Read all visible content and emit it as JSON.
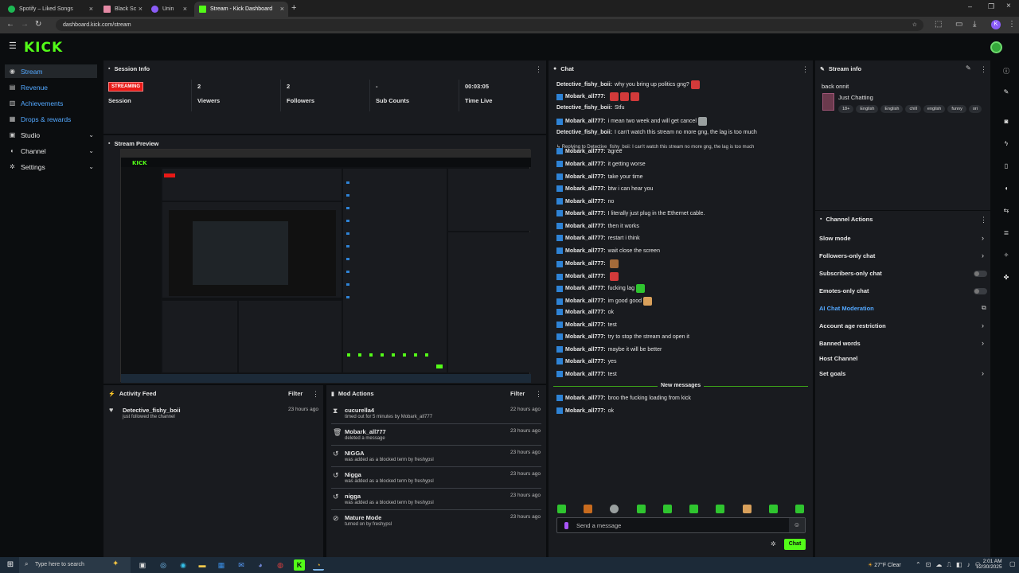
{
  "browser": {
    "tabs": [
      {
        "label": "Spotify – Liked Songs",
        "color": "#1db954"
      },
      {
        "label": "Black Sc",
        "color": "#e58aa5"
      },
      {
        "label": "Unin",
        "color": "#8a5cf6"
      },
      {
        "label": "Stream - Kick Dashboard",
        "color": "#53fc18"
      }
    ],
    "url": "dashboard.kick.com/stream"
  },
  "brand": {
    "logo": "KICK",
    "accent": "#53fc18",
    "link_blue": "#53a8ff"
  },
  "sidebar": {
    "items": [
      {
        "label": "Stream",
        "icon": "broadcast-icon"
      },
      {
        "label": "Revenue",
        "icon": "dollar-icon"
      },
      {
        "label": "Achievements",
        "icon": "trophy-icon"
      },
      {
        "label": "Drops & rewards",
        "icon": "gift-icon"
      },
      {
        "label": "Studio",
        "icon": "video-icon"
      },
      {
        "label": "Channel",
        "icon": "user-icon"
      },
      {
        "label": "Settings",
        "icon": "gear-icon"
      }
    ]
  },
  "session": {
    "title": "Session Info",
    "badge": "STREAMING",
    "session_label": "Session",
    "stats": [
      {
        "value": "2",
        "label": "Viewers"
      },
      {
        "value": "2",
        "label": "Followers"
      },
      {
        "value": "-",
        "label": "Sub Counts"
      },
      {
        "value": "00:03:05",
        "label": "Time Live"
      }
    ]
  },
  "preview": {
    "title": "Stream Preview"
  },
  "activity": {
    "title": "Activity Feed",
    "filter": "Filter",
    "items": [
      {
        "name": "Detective_fishy_boii",
        "desc": "just followed the channel",
        "time": "23 hours ago"
      }
    ]
  },
  "mod": {
    "title": "Mod Actions",
    "filter": "Filter",
    "items": [
      {
        "name": "cucurella4",
        "desc": "timed out for 5 minutes by Mobark_all777",
        "time": "22 hours ago",
        "icon": "hourglass-icon"
      },
      {
        "name": "Mobark_all777",
        "desc": "deleted a message",
        "time": "23 hours ago",
        "icon": "trash-icon"
      },
      {
        "name": "NIGGA",
        "desc": "was added as a blocked term by freshypsl",
        "time": "23 hours ago",
        "icon": "undo-icon"
      },
      {
        "name": "Nigga",
        "desc": "was added as a blocked term by freshypsl",
        "time": "23 hours ago",
        "icon": "undo-icon"
      },
      {
        "name": "nigga",
        "desc": "was added as a blocked term by freshypsl",
        "time": "23 hours ago",
        "icon": "undo-icon"
      },
      {
        "name": "Mature Mode",
        "desc": "turned on by freshypsl",
        "time": "23 hours ago",
        "icon": "slash-icon"
      }
    ]
  },
  "chat": {
    "title": "Chat",
    "messages": [
      {
        "user": "Detective_fishy_boii:",
        "text": "why you bring up politics gng?",
        "badge": false,
        "emotes": 1
      },
      {
        "user": "Mobark_all777:",
        "text": "",
        "badge": true,
        "emotes": 3
      },
      {
        "user": "Detective_fishy_boii:",
        "text": "Stfu",
        "badge": false,
        "emotes": 0
      },
      {
        "user": "Mobark_all777:",
        "text": "i mean two week and will get cancel",
        "badge": true,
        "emotes": 1
      },
      {
        "user": "Detective_fishy_boii:",
        "text": "I can't watch this stream no more gng, the lag is too much",
        "badge": false,
        "emotes": 0
      },
      {
        "user": "Mobark_all777:",
        "text": "agree",
        "badge": true,
        "emotes": 0,
        "reply": "Replying to Detective_fishy_boii: I can't watch this stream no more gng, the lag is too much"
      },
      {
        "user": "Mobark_all777:",
        "text": "it getting worse",
        "badge": true,
        "emotes": 0
      },
      {
        "user": "Mobark_all777:",
        "text": "take your time",
        "badge": true,
        "emotes": 0
      },
      {
        "user": "Mobark_all777:",
        "text": "btw i can hear you",
        "badge": true,
        "emotes": 0
      },
      {
        "user": "Mobark_all777:",
        "text": "no",
        "badge": true,
        "emotes": 0
      },
      {
        "user": "Mobark_all777:",
        "text": "I literally just plug in the Ethernet cable.",
        "badge": true,
        "emotes": 0
      },
      {
        "user": "Mobark_all777:",
        "text": "then it works",
        "badge": true,
        "emotes": 0
      },
      {
        "user": "Mobark_all777:",
        "text": "restart i think",
        "badge": true,
        "emotes": 0
      },
      {
        "user": "Mobark_all777:",
        "text": "wait close the screen",
        "badge": true,
        "emotes": 0
      },
      {
        "user": "Mobark_all777:",
        "text": "",
        "badge": true,
        "emotes": 1
      },
      {
        "user": "Mobark_all777:",
        "text": "",
        "badge": true,
        "emotes": 1
      },
      {
        "user": "Mobark_all777:",
        "text": "fucking lag",
        "badge": true,
        "emotes": 1
      },
      {
        "user": "Mobark_all777:",
        "text": "im good good",
        "badge": true,
        "emotes": 1
      },
      {
        "user": "Mobark_all777:",
        "text": "ok",
        "badge": true,
        "emotes": 0
      },
      {
        "user": "Mobark_all777:",
        "text": "test",
        "badge": true,
        "emotes": 0
      },
      {
        "user": "Mobark_all777:",
        "text": "try to stop the stream and open it",
        "badge": true,
        "emotes": 0
      },
      {
        "user": "Mobark_all777:",
        "text": "maybe it will be better",
        "badge": true,
        "emotes": 0
      },
      {
        "user": "Mobark_all777:",
        "text": "yes",
        "badge": true,
        "emotes": 0
      },
      {
        "user": "Mobark_all777:",
        "text": "test",
        "badge": true,
        "emotes": 0
      }
    ],
    "new_messages_label": "New messages",
    "new_messages": [
      {
        "user": "Mobark_all777:",
        "text": "broo the fucking loading from kick"
      },
      {
        "user": "Mobark_all777:",
        "text": "ok"
      }
    ],
    "input_placeholder": "Send a message",
    "send_label": "Chat"
  },
  "stream_info": {
    "title": "Stream info",
    "stream_title": "back onnit",
    "category": "Just Chatting",
    "tags": [
      "18+",
      "English",
      "English",
      "chill",
      "english",
      "funny",
      "ori"
    ]
  },
  "channel_actions": {
    "title": "Channel Actions",
    "items": [
      {
        "label": "Slow mode",
        "control": "chevron"
      },
      {
        "label": "Followers-only chat",
        "control": "chevron"
      },
      {
        "label": "Subscribers-only chat",
        "control": "toggle"
      },
      {
        "label": "Emotes-only chat",
        "control": "toggle"
      },
      {
        "label": "AI Chat Moderation",
        "control": "external"
      },
      {
        "label": "Account age restriction",
        "control": "chevron"
      },
      {
        "label": "Banned words",
        "control": "chevron"
      },
      {
        "label": "Host Channel",
        "control": "none"
      },
      {
        "label": "Set goals",
        "control": "chevron"
      }
    ]
  },
  "taskbar": {
    "search_placeholder": "Type here to search",
    "weather": "27°F  Clear",
    "time": "2:01 AM",
    "date": "12/30/2025"
  }
}
